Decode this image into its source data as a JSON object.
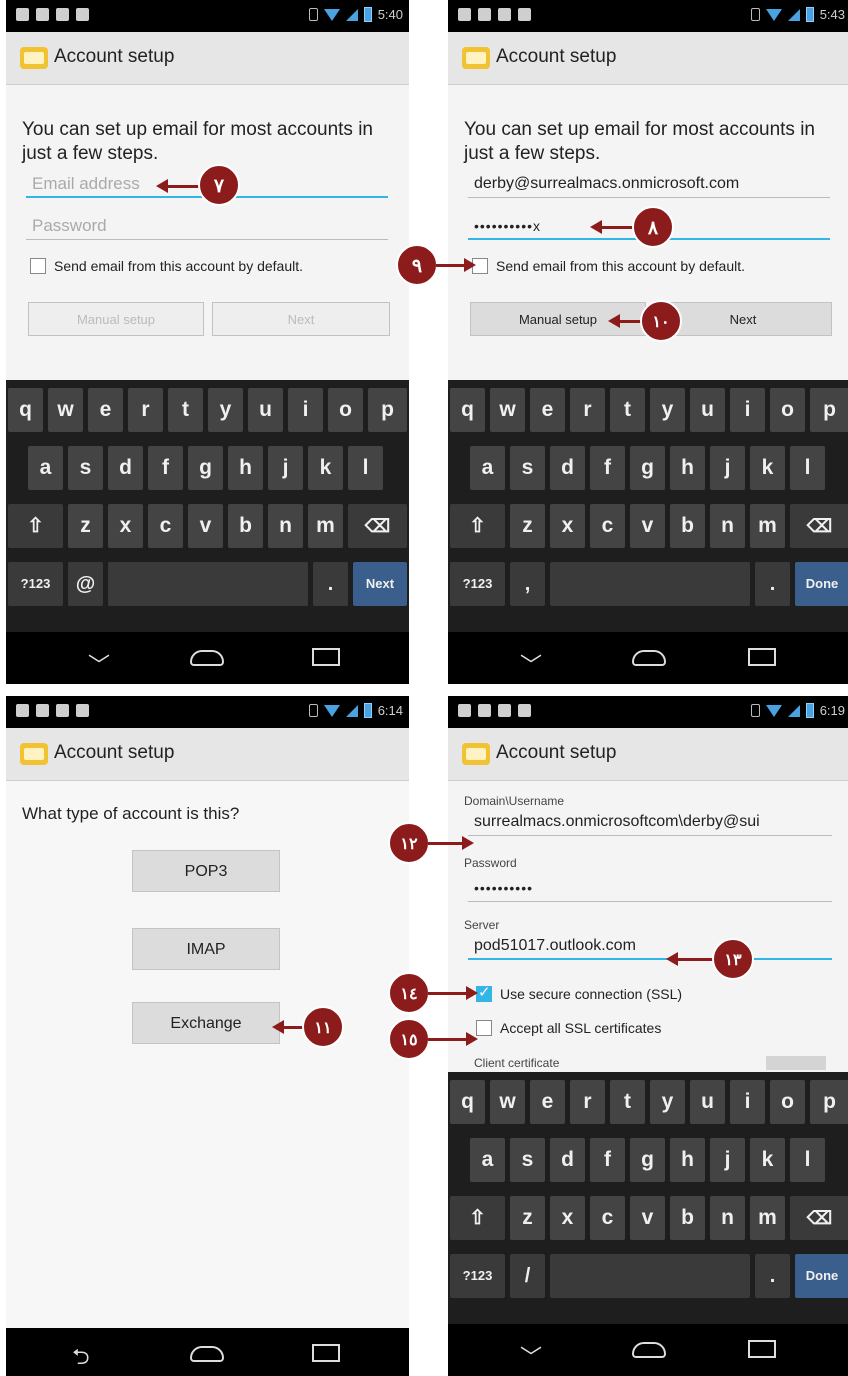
{
  "screens": {
    "s1": {
      "time": "5:40",
      "title": "Account setup",
      "intro": "You can set up email for most accounts in just a few steps.",
      "email_placeholder": "Email address",
      "password_placeholder": "Password",
      "checkbox_label": "Send email from this account by default.",
      "manual_btn": "Manual setup",
      "next_btn": "Next",
      "kb_action": "Next",
      "kb_left": "?123",
      "kb_sym": "@",
      "kb_dot": "."
    },
    "s2": {
      "time": "5:43",
      "title": "Account setup",
      "intro": "You can set up email for most accounts in just a few steps.",
      "email_value": "derby@surrealmacs.onmicrosoft.com",
      "password_value": "••••••••••x",
      "checkbox_label": "Send email from this account by default.",
      "manual_btn": "Manual setup",
      "next_btn": "Next",
      "kb_action": "Done",
      "kb_left": "?123",
      "kb_sym": ",",
      "kb_dot": "."
    },
    "s3": {
      "time": "6:14",
      "title": "Account setup",
      "question": "What type of account is this?",
      "pop3": "POP3",
      "imap": "IMAP",
      "exchange": "Exchange"
    },
    "s4": {
      "time": "6:19",
      "title": "Account setup",
      "domain_label": "Domain\\Username",
      "domain_value": "surrealmacs.onmicrosoftcom\\derby@sui",
      "password_label": "Password",
      "password_value": "••••••••••",
      "server_label": "Server",
      "server_value": "pod51017.outlook.com",
      "ssl_label": "Use secure connection (SSL)",
      "accept_label": "Accept all SSL certificates",
      "client_cert_label": "Client certificate",
      "kb_action": "Done",
      "kb_left": "?123",
      "kb_sym": "/",
      "kb_dot": "."
    }
  },
  "keyboard_rows": {
    "row1": [
      "q",
      "w",
      "e",
      "r",
      "t",
      "y",
      "u",
      "i",
      "o",
      "p"
    ],
    "row2": [
      "a",
      "s",
      "d",
      "f",
      "g",
      "h",
      "j",
      "k",
      "l"
    ],
    "row3": [
      "z",
      "x",
      "c",
      "v",
      "b",
      "n",
      "m"
    ]
  },
  "callouts": {
    "c7": "٧",
    "c8": "٨",
    "c9": "٩",
    "c10": "١٠",
    "c11": "١١",
    "c12": "١٢",
    "c13": "١٣",
    "c14": "١٤",
    "c15": "١٥"
  },
  "colors": {
    "accent": "#33b5e5",
    "callout": "#8c1c1c",
    "keyboard_bg": "#1e1e1e",
    "action_key": "#3b5f8c"
  }
}
